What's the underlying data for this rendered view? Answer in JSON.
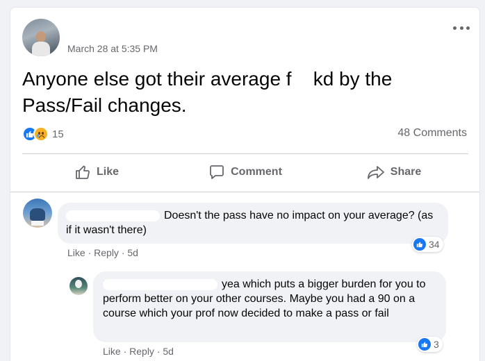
{
  "post": {
    "timestamp": "March 28 at 5:35 PM",
    "text": "Anyone else got their average f    kd by the Pass/Fail changes.",
    "reaction_count": "15",
    "reactions": [
      "like",
      "sad"
    ],
    "comments_count": "48 Comments"
  },
  "actions": {
    "like": "Like",
    "comment": "Comment",
    "share": "Share"
  },
  "comments": [
    {
      "text": "Doesn't the pass have no impact on your average? (as if it wasn't there)",
      "like_label": "Like",
      "reply_label": "Reply",
      "age": "5d",
      "likes": "34"
    },
    {
      "text": "yea which puts a bigger burden for you to perform better on your other courses. Maybe you had a 90 on a course which your prof now decided to make a pass or fail",
      "like_label": "Like",
      "reply_label": "Reply",
      "age": "5d",
      "likes": "3"
    }
  ],
  "colors": {
    "like_blue": "#1877f2",
    "secondary_text": "#65676b",
    "bubble_bg": "#f0f2f5"
  },
  "icons": [
    "more-icon",
    "like-reaction-icon",
    "sad-reaction-icon",
    "thumbs-up-icon",
    "comment-icon",
    "share-icon"
  ]
}
